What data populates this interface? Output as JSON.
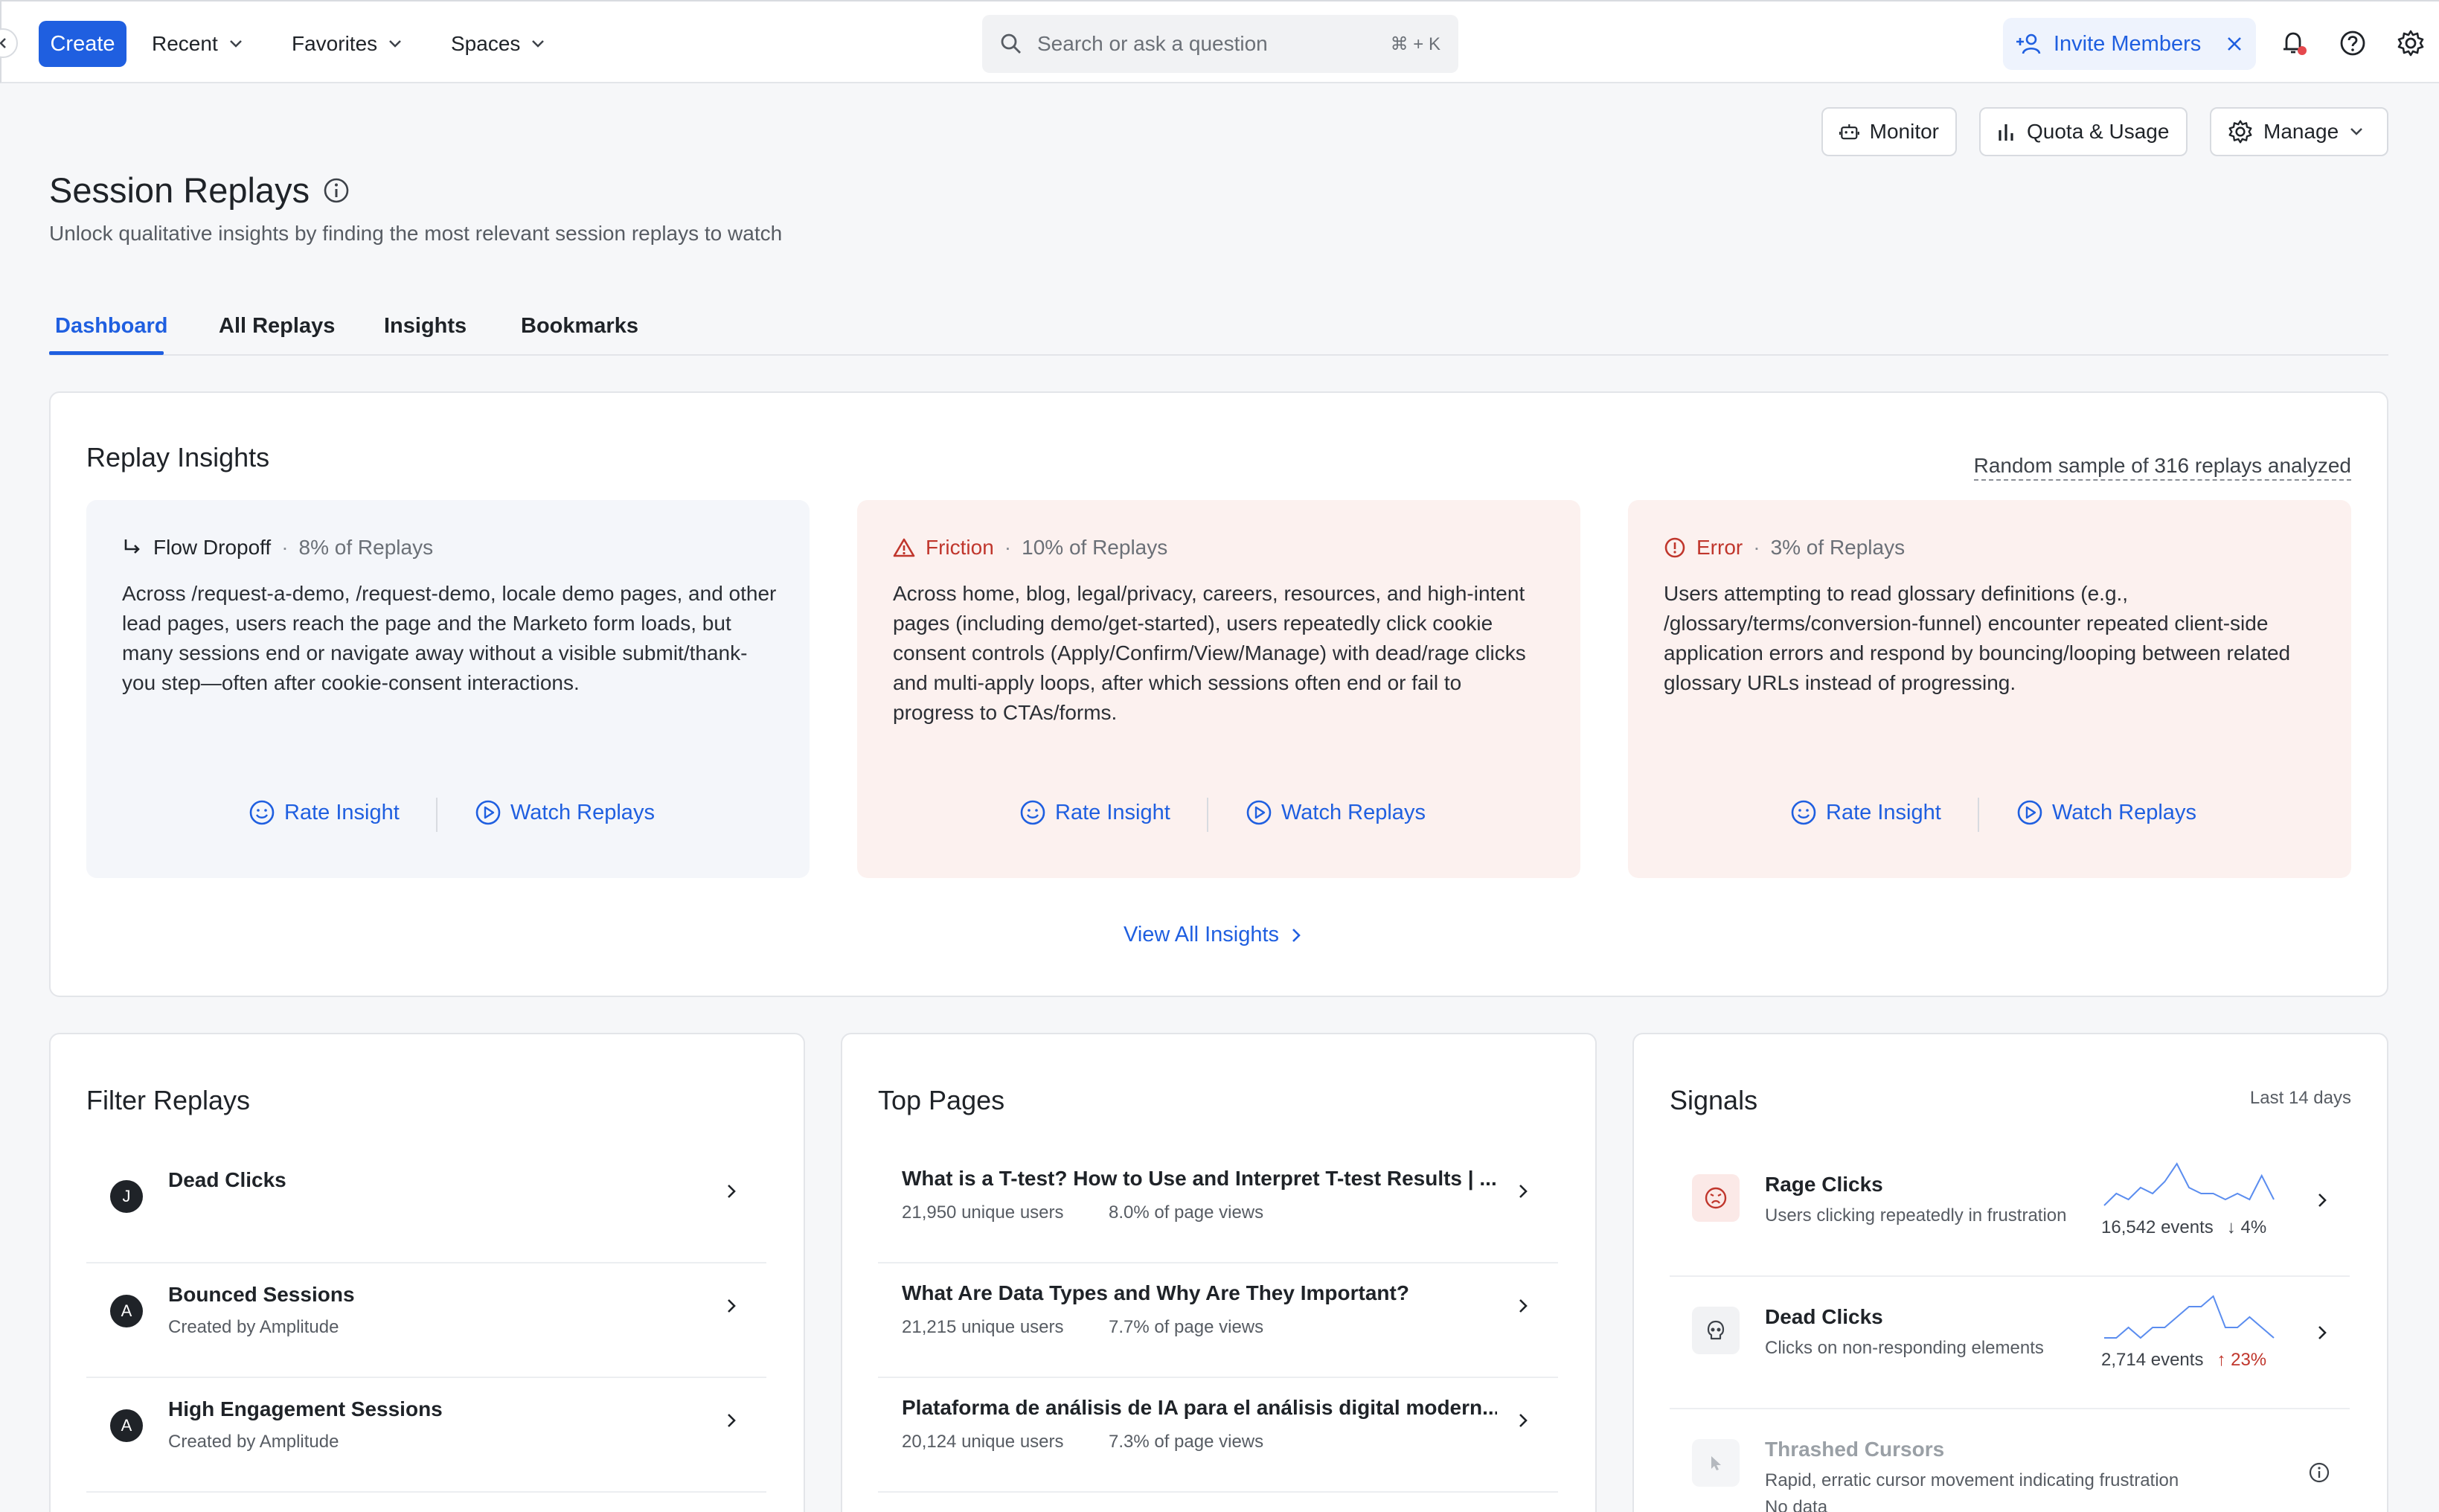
{
  "topbar": {
    "create_label": "Create",
    "nav": [
      {
        "label": "Recent"
      },
      {
        "label": "Favorites"
      },
      {
        "label": "Spaces"
      }
    ],
    "search_placeholder": "Search or ask a question",
    "search_shortcut": "⌘ + K",
    "invite_label": "Invite Members"
  },
  "header": {
    "monitor_label": "Monitor",
    "quota_label": "Quota & Usage",
    "manage_label": "Manage",
    "title": "Session Replays",
    "subtitle": "Unlock qualitative insights by finding the most relevant session replays to watch"
  },
  "tabs": [
    {
      "label": "Dashboard",
      "active": true
    },
    {
      "label": "All Replays"
    },
    {
      "label": "Insights"
    },
    {
      "label": "Bookmarks"
    }
  ],
  "insights": {
    "title": "Replay Insights",
    "sample_text": "Random sample of 316 replays analyzed",
    "cards": [
      {
        "kind": "Flow Dropoff",
        "pct": "8% of Replays",
        "icon": "arrow-down-right-icon",
        "body": "Across /request-a-demo, /request-demo, locale demo pages, and other lead pages, users reach the page and the Marketo form loads, but many sessions end or navigate away without a visible submit/thank-you step—often after cookie-consent interactions.",
        "rate_label": "Rate Insight",
        "watch_label": "Watch Replays"
      },
      {
        "kind": "Friction",
        "pct": "10% of Replays",
        "icon": "warning-triangle-icon",
        "body": "Across home, blog, legal/privacy, careers, resources, and high-intent pages (including demo/get-started), users repeatedly click cookie consent controls (Apply/Confirm/View/Manage) with dead/rage clicks and multi-apply loops, after which sessions often end or fail to progress to CTAs/forms.",
        "rate_label": "Rate Insight",
        "watch_label": "Watch Replays"
      },
      {
        "kind": "Error",
        "pct": "3% of Replays",
        "icon": "error-circle-icon",
        "body": "Users attempting to read glossary definitions (e.g., /glossary/terms/conversion-funnel) encounter repeated client-side application errors and respond by bouncing/looping between related glossary URLs instead of progressing.",
        "rate_label": "Rate Insight",
        "watch_label": "Watch Replays"
      }
    ],
    "view_all_label": "View All Insights"
  },
  "filters": {
    "title": "Filter Replays",
    "items": [
      {
        "avatar": "J",
        "title": "Dead Clicks",
        "subtitle": ""
      },
      {
        "avatar": "A",
        "title": "Bounced Sessions",
        "subtitle": "Created by Amplitude"
      },
      {
        "avatar": "A",
        "title": "High Engagement Sessions",
        "subtitle": "Created by Amplitude"
      }
    ]
  },
  "top_pages": {
    "title": "Top Pages",
    "items": [
      {
        "title": "What is a T-test? How to Use and Interpret T-test Results | ...",
        "users": "21,950 unique users",
        "views": "8.0% of page views"
      },
      {
        "title": "What Are Data Types and Why Are They Important?",
        "users": "21,215 unique users",
        "views": "7.7% of page views"
      },
      {
        "title": "Plataforma de análisis de IA para el análisis digital modern...",
        "users": "20,124 unique users",
        "views": "7.3% of page views"
      }
    ]
  },
  "signals": {
    "title": "Signals",
    "range": "Last 14 days",
    "items": [
      {
        "title": "Rage Clicks",
        "desc": "Users clicking repeatedly in frustration",
        "events": "16,542 events",
        "trend": "↓ 4%",
        "trend_dir": "down",
        "icon": "angry-face-icon",
        "spark": [
          2,
          4,
          3,
          5,
          4,
          6,
          9,
          5,
          4,
          4,
          3,
          4,
          3,
          7,
          3
        ]
      },
      {
        "title": "Dead Clicks",
        "desc": "Clicks on non-responding elements",
        "events": "2,714 events",
        "trend": "↑ 23%",
        "trend_dir": "up",
        "icon": "skull-icon",
        "spark": [
          3,
          3,
          4,
          3,
          4,
          4,
          5,
          6,
          6,
          7,
          4,
          4,
          5,
          4,
          3
        ]
      },
      {
        "title": "Thrashed Cursors",
        "desc": "Rapid, erratic cursor movement indicating frustration",
        "status": "No data",
        "icon": "cursor-icon"
      }
    ]
  },
  "colors": {
    "accent": "#1f5fe0",
    "danger": "#c0362c",
    "spark": "#5b8def"
  }
}
